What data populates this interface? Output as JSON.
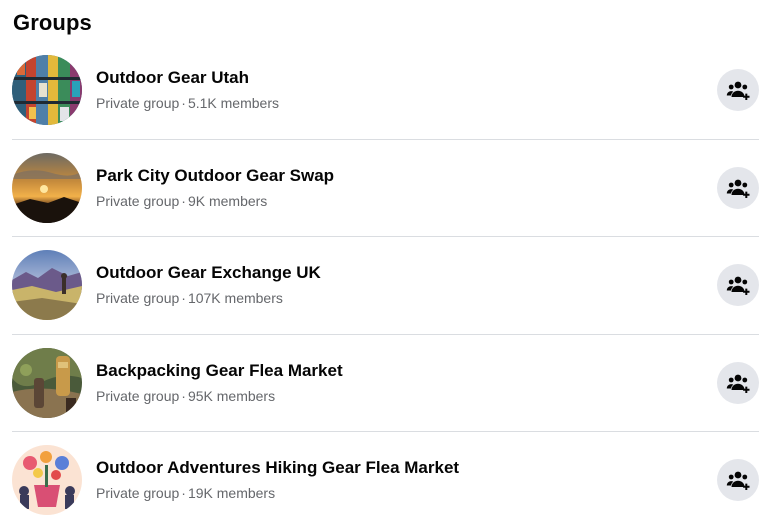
{
  "section": {
    "title": "Groups"
  },
  "groups": [
    {
      "name": "Outdoor Gear Utah",
      "privacy": "Private group",
      "separator": "·",
      "members": "5.1K members"
    },
    {
      "name": "Park City Outdoor Gear Swap",
      "privacy": "Private group",
      "separator": "·",
      "members": "9K members"
    },
    {
      "name": "Outdoor Gear Exchange UK",
      "privacy": "Private group",
      "separator": "·",
      "members": "107K members"
    },
    {
      "name": "Backpacking Gear Flea Market",
      "privacy": "Private group",
      "separator": "·",
      "members": "95K members"
    },
    {
      "name": "Outdoor Adventures Hiking Gear Flea Market",
      "privacy": "Private group",
      "separator": "·",
      "members": "19K members"
    }
  ],
  "icons": {
    "join": "group-join-icon"
  },
  "colors": {
    "primary_text": "#050505",
    "secondary_text": "#65676b",
    "button_bg": "#e4e6eb",
    "divider": "#dadde1"
  }
}
